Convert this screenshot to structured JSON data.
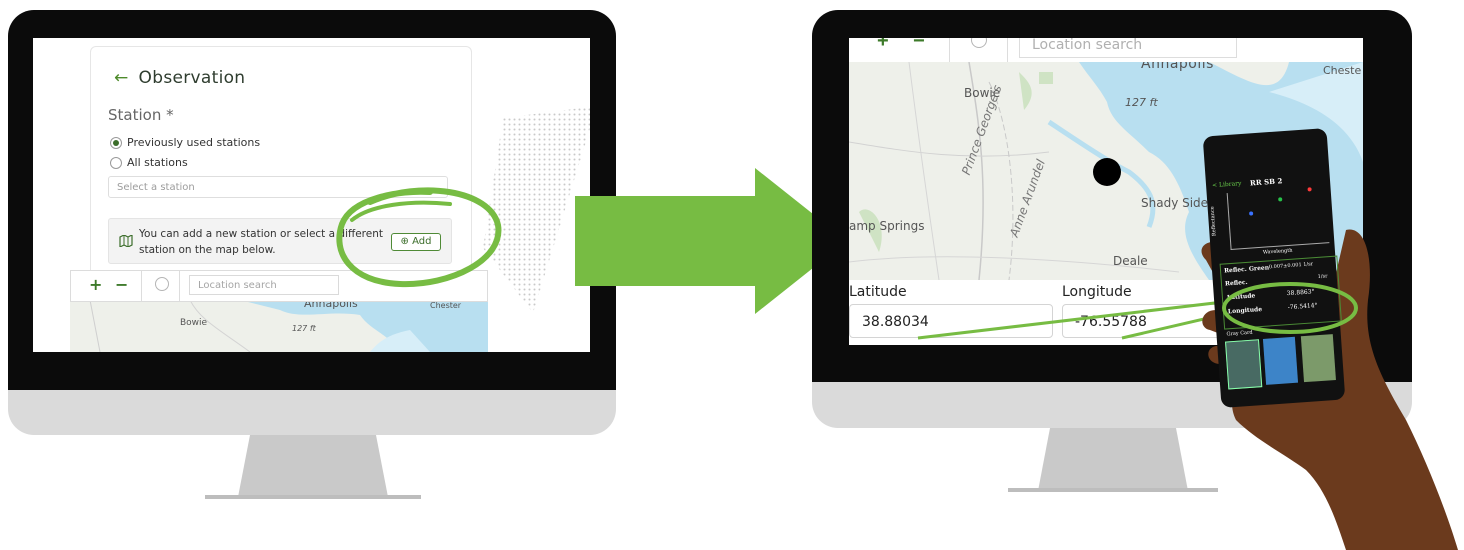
{
  "left_screen": {
    "page_title": "Observation",
    "back_icon": "arrow-left-icon",
    "station_label": "Station *",
    "radio_options": [
      {
        "label": "Previously used stations",
        "selected": true
      },
      {
        "label": "All stations",
        "selected": false
      }
    ],
    "select_placeholder": "Select a station",
    "info_text": "You can add a new station or select a different station on the map below.",
    "info_icon": "map-icon",
    "add_button": "Add",
    "add_icon": "plus-circle-icon",
    "zoom_in": "+",
    "zoom_out": "−",
    "locate_icon": "crosshair-icon",
    "search_placeholder": "Location search",
    "map_labels": {
      "annapolis": "Annapolis",
      "chester": "Chester",
      "bowie": "Bowie",
      "elevation": "127 ft"
    }
  },
  "right_screen": {
    "search_placeholder": "Location search",
    "map_labels": {
      "annapolis": "Annapolis",
      "chester": "Cheste",
      "bowie": "Bowie",
      "elevation": "127 ft",
      "shady_side": "Shady Side",
      "camp_springs": "amp Springs",
      "prince_georges": "Prince George's",
      "anne_arundel": "Anne Arundel",
      "deale": "Deale"
    },
    "latitude_label": "Latitude",
    "latitude_value": "38.88034",
    "longitude_label": "Longitude",
    "longitude_value": "-76.55788"
  },
  "phone": {
    "back_label": "Library",
    "title": "RR SB 2",
    "y_axis": "Reflectance",
    "x_axis": "Wavelength",
    "row_reflec": "Reflec. Green",
    "row_reflec_value": "0.007±0.001 1/sr",
    "row_reflec2": "Reflec.",
    "row_reflec2_value": "1/sr",
    "lat_label": "Latitude",
    "lat_value": "38.8863°",
    "lon_label": "Longitude",
    "lon_value": "-76.5414°",
    "gray_card": "Gray Card"
  },
  "colors": {
    "accent": "#77bc43",
    "ui_green": "#3b6d2a",
    "water": "#b8dff0",
    "land": "#eef0ea"
  }
}
